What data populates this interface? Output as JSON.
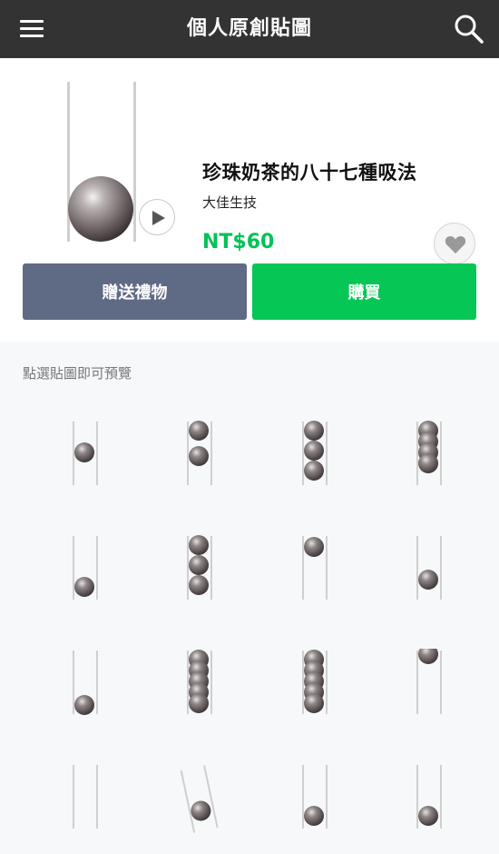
{
  "header": {
    "title": "個人原創貼圖"
  },
  "product": {
    "name": "珍珠奶茶的八十七種吸法",
    "author": "大佳生技",
    "price": "NT$60"
  },
  "actions": {
    "gift_label": "贈送禮物",
    "buy_label": "購買"
  },
  "preview_hint": "點選貼圖即可預覽",
  "colors": {
    "header_bg": "#333333",
    "price_green": "#00c356",
    "buy_green": "#06c755",
    "gift_slate": "#5f6a85"
  },
  "stickers": [
    {
      "pearls": 1
    },
    {
      "pearls": 2
    },
    {
      "pearls": 3
    },
    {
      "pearls": 4
    },
    {
      "pearls": 1
    },
    {
      "pearls": 3
    },
    {
      "pearls": 1
    },
    {
      "pearls": 1
    },
    {
      "pearls": 1
    },
    {
      "pearls": 5
    },
    {
      "pearls": 5
    },
    {
      "pearls": 1
    },
    {
      "pearls": 0
    },
    {
      "pearls": 1
    },
    {
      "pearls": 1
    },
    {
      "pearls": 1
    }
  ]
}
